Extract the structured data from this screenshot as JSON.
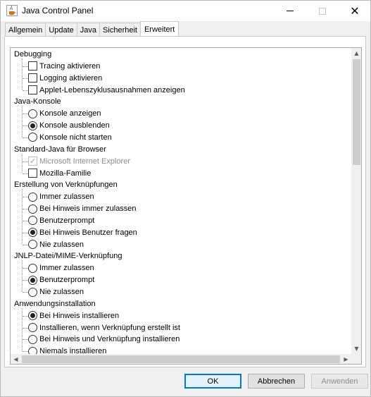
{
  "window": {
    "title": "Java Control Panel",
    "icons": {
      "app": "java-cup-icon",
      "minimize": "minimize-icon",
      "maximize": "maximize-icon",
      "close": "close-icon"
    }
  },
  "tabs": [
    {
      "label": "Allgemein",
      "active": false
    },
    {
      "label": "Update",
      "active": false
    },
    {
      "label": "Java",
      "active": false
    },
    {
      "label": "Sicherheit",
      "active": false
    },
    {
      "label": "Erweitert",
      "active": true
    }
  ],
  "tree": [
    {
      "label": "Debugging",
      "items": [
        {
          "type": "checkbox",
          "label": "Tracing aktivieren",
          "checked": false,
          "disabled": false
        },
        {
          "type": "checkbox",
          "label": "Logging aktivieren",
          "checked": false,
          "disabled": false
        },
        {
          "type": "checkbox",
          "label": "Applet-Lebenszyklusausnahmen anzeigen",
          "checked": false,
          "disabled": false
        }
      ]
    },
    {
      "label": "Java-Konsole",
      "items": [
        {
          "type": "radio",
          "label": "Konsole anzeigen",
          "checked": false
        },
        {
          "type": "radio",
          "label": "Konsole ausblenden",
          "checked": true
        },
        {
          "type": "radio",
          "label": "Konsole nicht starten",
          "checked": false
        }
      ]
    },
    {
      "label": "Standard-Java für Browser",
      "items": [
        {
          "type": "checkbox",
          "label": "Microsoft Internet Explorer",
          "checked": true,
          "disabled": true
        },
        {
          "type": "checkbox",
          "label": "Mozilla-Familie",
          "checked": false,
          "disabled": false
        }
      ]
    },
    {
      "label": "Erstellung von Verknüpfungen",
      "items": [
        {
          "type": "radio",
          "label": "Immer zulassen",
          "checked": false
        },
        {
          "type": "radio",
          "label": "Bei Hinweis immer zulassen",
          "checked": false
        },
        {
          "type": "radio",
          "label": "Benutzerprompt",
          "checked": false
        },
        {
          "type": "radio",
          "label": "Bei Hinweis Benutzer fragen",
          "checked": true
        },
        {
          "type": "radio",
          "label": "Nie zulassen",
          "checked": false
        }
      ]
    },
    {
      "label": "JNLP-Datei/MIME-Verknüpfung",
      "items": [
        {
          "type": "radio",
          "label": "Immer zulassen",
          "checked": false
        },
        {
          "type": "radio",
          "label": "Benutzerprompt",
          "checked": true
        },
        {
          "type": "radio",
          "label": "Nie zulassen",
          "checked": false
        }
      ]
    },
    {
      "label": "Anwendungsinstallation",
      "items": [
        {
          "type": "radio",
          "label": "Bei Hinweis installieren",
          "checked": true
        },
        {
          "type": "radio",
          "label": "Installieren, wenn Verknüpfung erstellt ist",
          "checked": false
        },
        {
          "type": "radio",
          "label": "Bei Hinweis und Verknüpfung installieren",
          "checked": false
        },
        {
          "type": "radio",
          "label": "Niemals installieren",
          "checked": false
        }
      ]
    }
  ],
  "buttons": {
    "ok": "OK",
    "cancel": "Abbrechen",
    "apply": "Anwenden"
  }
}
